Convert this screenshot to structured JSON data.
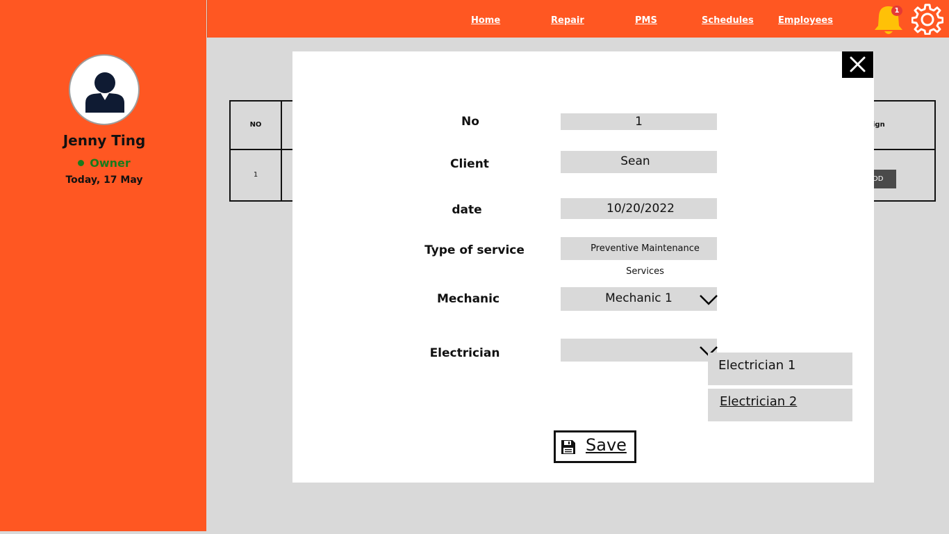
{
  "sidebar": {
    "user_name": "Jenny Ting",
    "user_role": "Owner",
    "date": "Today, 17 May"
  },
  "nav": {
    "links": [
      "Home",
      "Repair",
      "PMS",
      "Schedules",
      "Employees"
    ],
    "notification_count": "1"
  },
  "background_table": {
    "header_no": "NO",
    "header_assign_partial": "ign",
    "row_no": "1",
    "add_button_partial": "DD"
  },
  "modal": {
    "fields": {
      "no": {
        "label": "No",
        "value": "1"
      },
      "client": {
        "label": "Client",
        "value": "Sean"
      },
      "date": {
        "label": "date",
        "value": "10/20/2022"
      },
      "service": {
        "label": "Type of service",
        "value": "Preventive Maintenance Services"
      },
      "mechanic": {
        "label": "Mechanic",
        "value": "Mechanic 1"
      },
      "electrician": {
        "label": "Electrician",
        "value": ""
      }
    },
    "electrician_options": [
      "Electrician 1",
      "Electrician 2"
    ],
    "save_label": "Save"
  },
  "colors": {
    "brand": "#ff5722",
    "status_online": "#1b7a1b",
    "badge": "#e53935"
  },
  "icons": [
    "user-avatar-icon",
    "bell-icon",
    "gear-icon",
    "close-icon",
    "chevron-down-icon",
    "floppy-disk-icon"
  ]
}
